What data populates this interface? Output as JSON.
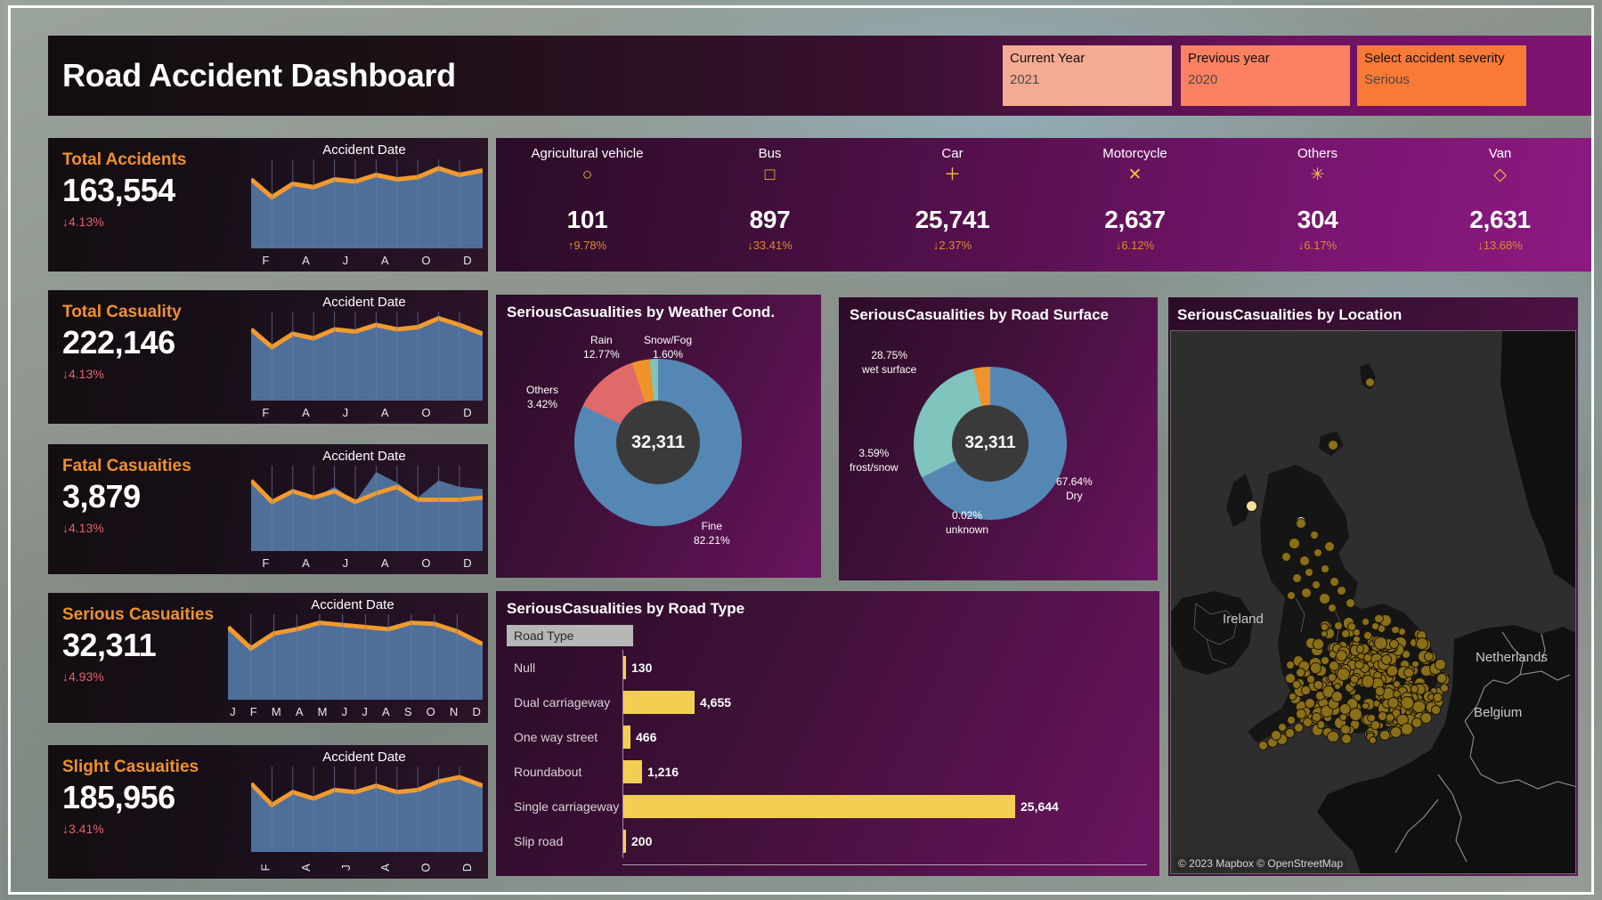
{
  "header": {
    "title": "Road Accident Dashboard",
    "filters": [
      {
        "label": "Current Year",
        "value": "2021",
        "color": "#f5ab93"
      },
      {
        "label": "Previous year",
        "value": "2020",
        "color": "#fb8162"
      },
      {
        "label": "Select accident severity",
        "value": "Serious",
        "color": "#f97a36"
      }
    ]
  },
  "kpis": [
    {
      "title": "Total Accidents",
      "value": "163,554",
      "delta": "↓4.13%",
      "spark_title": "Accident Date",
      "axis": [
        "F",
        "A",
        "J",
        "A",
        "O",
        "D"
      ],
      "rotated": false
    },
    {
      "title": "Total Casuality",
      "value": "222,146",
      "delta": "↓4.13%",
      "spark_title": "Accident Date",
      "axis": [
        "F",
        "A",
        "J",
        "A",
        "O",
        "D"
      ],
      "rotated": false
    },
    {
      "title": "Fatal Casuaities",
      "value": "3,879",
      "delta": "↓4.13%",
      "spark_title": "Accident Date",
      "axis": [
        "F",
        "A",
        "J",
        "A",
        "O",
        "D"
      ],
      "rotated": false
    },
    {
      "title": "Serious Casuaities",
      "value": "32,311",
      "delta": "↓4.93%",
      "spark_title": "Accident Date",
      "axis": [
        "J",
        "F",
        "M",
        "A",
        "M",
        "J",
        "J",
        "A",
        "S",
        "O",
        "N",
        "D"
      ],
      "rotated": false
    },
    {
      "title": "Slight Casuaities",
      "value": "185,956",
      "delta": "↓3.41%",
      "spark_title": "Accident Date",
      "axis": [
        "F",
        "A",
        "J",
        "A",
        "O",
        "D"
      ],
      "rotated": true
    }
  ],
  "vehicles": [
    {
      "name": "Agricultural vehicle",
      "icon": "○",
      "icon_name": "circle-marker-icon",
      "value": "101",
      "delta": "↑9.78%"
    },
    {
      "name": "Bus",
      "icon": "□",
      "icon_name": "square-marker-icon",
      "value": "897",
      "delta": "↓33.41%"
    },
    {
      "name": "Car",
      "icon": "＋",
      "icon_name": "plus-marker-icon",
      "value": "25,741",
      "delta": "↓2.37%"
    },
    {
      "name": "Motorcycle",
      "icon": "✕",
      "icon_name": "cross-marker-icon",
      "value": "2,637",
      "delta": "↓6.12%"
    },
    {
      "name": "Others",
      "icon": "✳",
      "icon_name": "asterisk-marker-icon",
      "value": "304",
      "delta": "↓6.17%"
    },
    {
      "name": "Van",
      "icon": "◇",
      "icon_name": "diamond-marker-icon",
      "value": "2,631",
      "delta": "↓13.68%"
    }
  ],
  "chart_data": [
    {
      "type": "pie",
      "title": "SeriousCasualities by Weather Cond.",
      "center_label": "32,311",
      "labels": [
        "Fine",
        "Rain",
        "Others",
        "Snow/Fog"
      ],
      "values": [
        82.21,
        12.77,
        3.42,
        1.6
      ],
      "value_suffix": "%",
      "colors": [
        "#5587b5",
        "#e06a6a",
        "#f0922c",
        "#7fc4bd"
      ],
      "legend": "labels-around-slices"
    },
    {
      "type": "pie",
      "title": "SeriousCasualities by Road Surface",
      "center_label": "32,311",
      "labels": [
        "Dry",
        "wet surface",
        "frost/snow",
        "unknown"
      ],
      "values": [
        67.64,
        28.75,
        3.59,
        0.02
      ],
      "value_suffix": "%",
      "colors": [
        "#5587b5",
        "#7fc4bd",
        "#f0922c",
        "#5587b5"
      ],
      "legend": "labels-around-slices"
    },
    {
      "type": "bar",
      "orientation": "horizontal",
      "title": "SeriousCasualities by Road Type",
      "column_header": "Road Type",
      "categories": [
        "Null",
        "Dual carriageway",
        "One way street",
        "Roundabout",
        "Single carriageway",
        "Slip road"
      ],
      "values": [
        130,
        4655,
        466,
        1216,
        25644,
        200
      ],
      "value_labels": [
        "130",
        "4,655",
        "466",
        "1,216",
        "25,644",
        "200"
      ],
      "bar_color": "#f2cf52",
      "xlim": [
        0,
        25644
      ],
      "grid": false
    }
  ],
  "map": {
    "title": "SeriousCasualities by Location",
    "attribution": "© 2023 Mapbox © OpenStreetMap",
    "labels": [
      "Ireland",
      "Netherlands",
      "Belgium"
    ],
    "marker_color": "#8a6f18"
  }
}
